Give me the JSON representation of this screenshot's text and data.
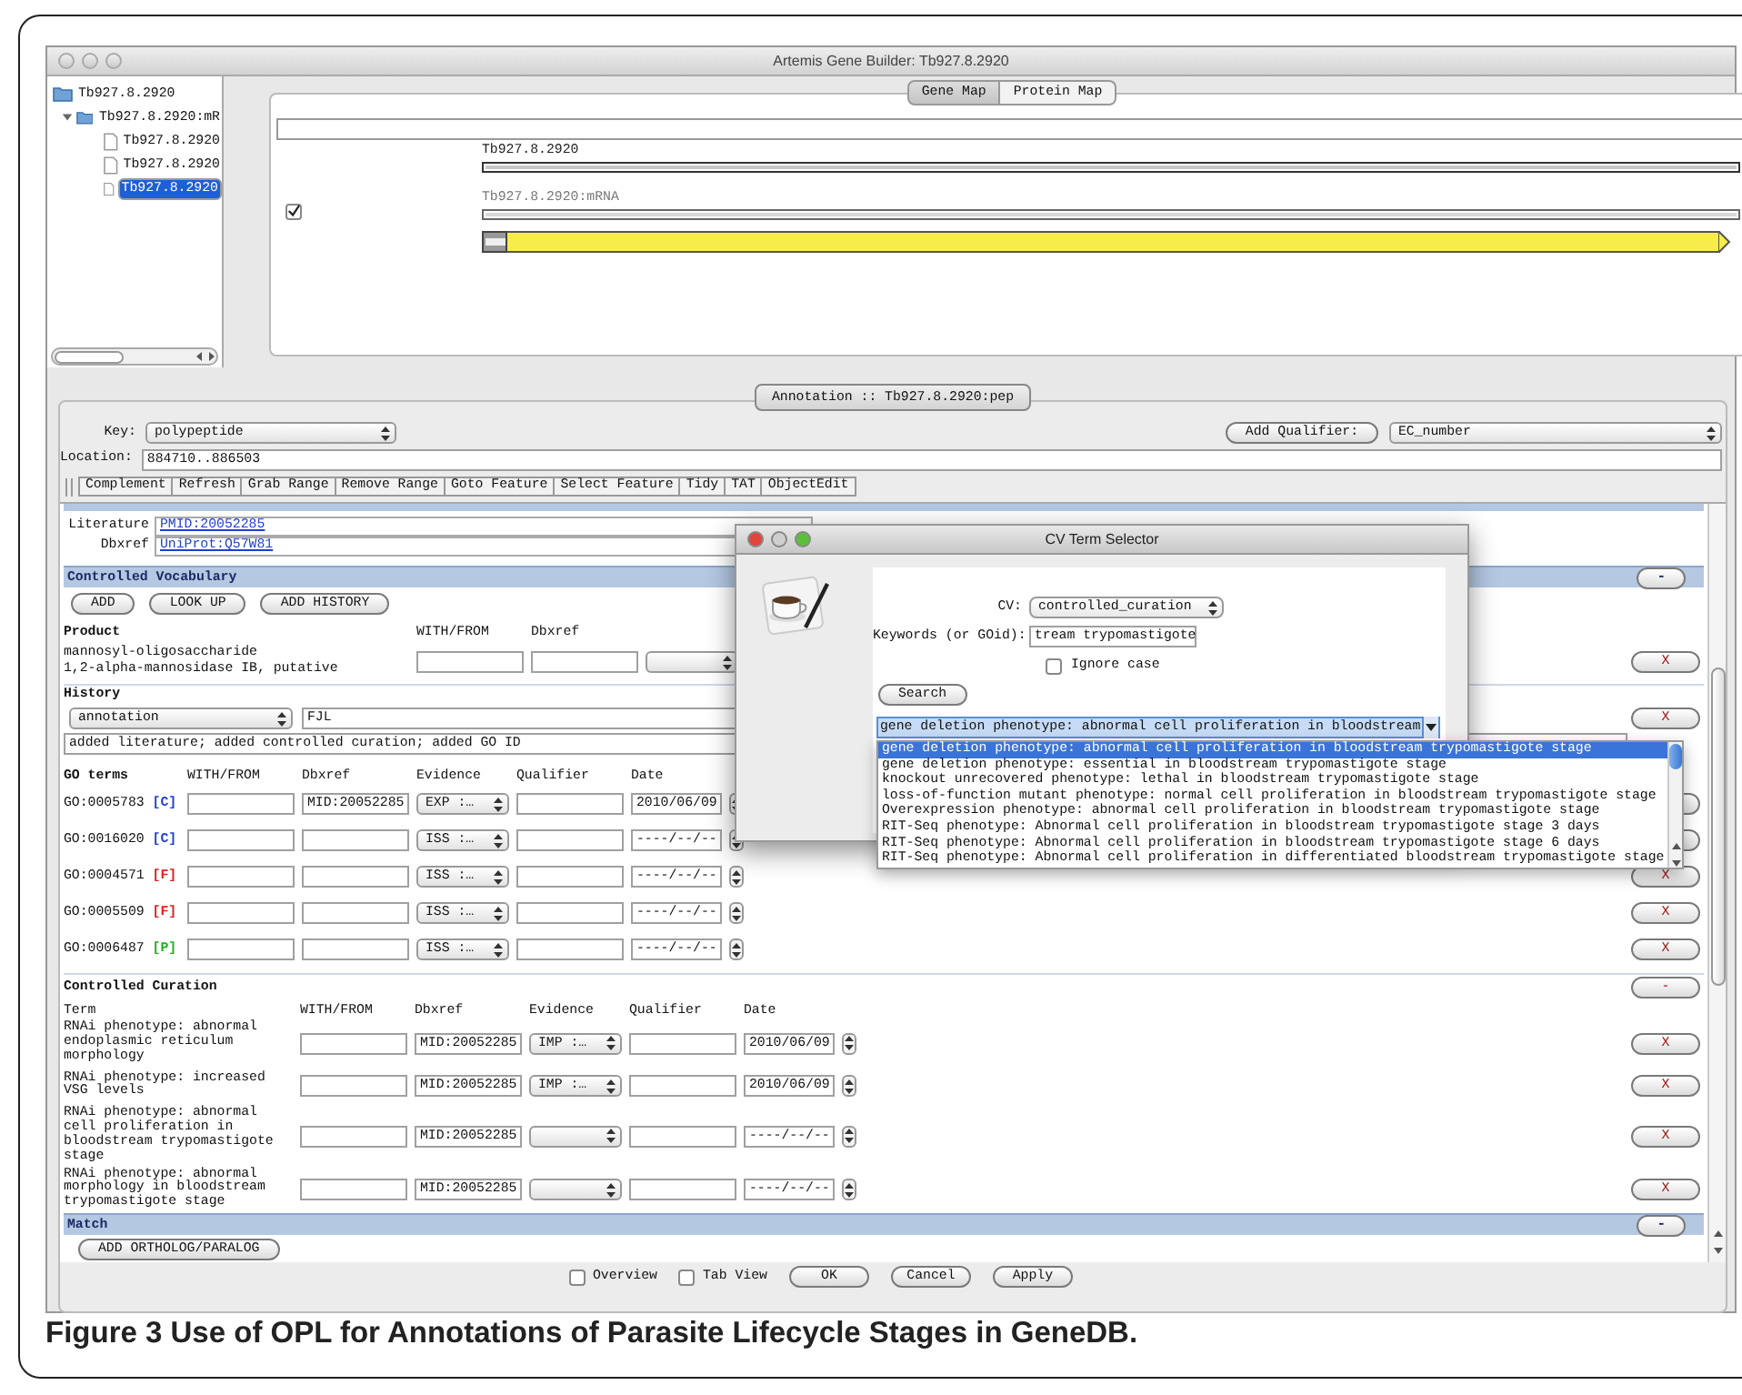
{
  "window": {
    "title": "Artemis Gene Builder: Tb927.8.2920"
  },
  "tree": [
    {
      "label": "Tb927.8.2920",
      "kind": "folder",
      "selected": false,
      "children": [
        {
          "label": "Tb927.8.2920:mR",
          "kind": "folder",
          "selected": false,
          "expanded": true,
          "children": [
            {
              "label": "Tb927.8.2920",
              "kind": "file",
              "selected": false
            },
            {
              "label": "Tb927.8.2920",
              "kind": "file",
              "selected": false
            },
            {
              "label": "Tb927.8.2920",
              "kind": "file",
              "selected": true
            }
          ]
        }
      ]
    }
  ],
  "map_tabs": [
    {
      "label": "Gene Map",
      "selected": true
    },
    {
      "label": "Protein Map",
      "selected": false
    }
  ],
  "gene_map": {
    "checked": true,
    "features": [
      {
        "kind": "gene",
        "label": "Tb927.8.2920"
      },
      {
        "kind": "mrna",
        "label": "Tb927.8.2920:mRNA"
      },
      {
        "kind": "cds"
      }
    ]
  },
  "annotation_tab": "Annotation :: Tb927.8.2920:pep",
  "key": {
    "label": "Key:",
    "value": "polypeptide"
  },
  "add_qualifier": {
    "button": "Add Qualifier:",
    "value": "EC_number"
  },
  "location": {
    "label": "Location:",
    "value": "884710..886503"
  },
  "toolbar": [
    "Complement",
    "Refresh",
    "Grab Range",
    "Remove Range",
    "Goto Feature",
    "Select Feature",
    "Tidy",
    "TAT",
    "ObjectEdit"
  ],
  "references": [
    {
      "label": "Literature",
      "value": "PMID:20052285"
    },
    {
      "label": "Dbxref",
      "value": "UniProt:Q57W81"
    }
  ],
  "controlled_vocabulary": {
    "title": "Controlled Vocabulary",
    "collapse": "-",
    "buttons": [
      "ADD",
      "LOOK UP",
      "ADD HISTORY"
    ]
  },
  "product": {
    "title": "Product",
    "columns": [
      "WITH/FROM",
      "Dbxref"
    ],
    "lines": [
      "mannosyl-oligosaccharide",
      "1,2-alpha-mannosidase IB, putative"
    ],
    "remove": "X"
  },
  "history": {
    "title": "History",
    "type": "annotation",
    "curator": "FJL",
    "text": "added literature; added controlled curation; added GO ID",
    "remove": "X"
  },
  "go_terms": {
    "columns": [
      "GO terms",
      "WITH/FROM",
      "Dbxref",
      "Evidence",
      "Qualifier",
      "Date"
    ],
    "rows": [
      {
        "id": "GO:0005783",
        "aspect": "[C]",
        "color": "#1f3fd0",
        "dbxref": "MID:20052285",
        "evidence": "EXP :…",
        "date": "2010/06/09"
      },
      {
        "id": "GO:0016020",
        "aspect": "[C]",
        "color": "#1f3fd0",
        "evidence": "ISS :…",
        "date": "----/--/--"
      },
      {
        "id": "GO:0004571",
        "aspect": "[F]",
        "color": "#e02020",
        "evidence": "ISS :…",
        "date": "----/--/--",
        "remove": "X"
      },
      {
        "id": "GO:0005509",
        "aspect": "[F]",
        "color": "#e02020",
        "evidence": "ISS :…",
        "date": "----/--/--",
        "remove": "X"
      },
      {
        "id": "GO:0006487",
        "aspect": "[P]",
        "color": "#20b020",
        "evidence": "ISS :…",
        "date": "----/--/--",
        "remove": "X"
      }
    ]
  },
  "controlled_curation": {
    "title": "Controlled Curation",
    "collapse": "-",
    "columns": [
      "Term",
      "WITH/FROM",
      "Dbxref",
      "Evidence",
      "Qualifier",
      "Date"
    ],
    "rows": [
      {
        "term": "RNAi phenotype: abnormal endoplasmic reticulum morphology",
        "dbxref": "MID:20052285",
        "evidence": "IMP :…",
        "date": "2010/06/09",
        "remove": "X"
      },
      {
        "term": "RNAi phenotype: increased VSG levels",
        "dbxref": "MID:20052285",
        "evidence": "IMP :…",
        "date": "2010/06/09",
        "remove": "X"
      },
      {
        "term": "RNAi phenotype: abnormal cell proliferation in bloodstream trypomastigote stage",
        "dbxref": "MID:20052285",
        "date": "----/--/--",
        "remove": "X"
      },
      {
        "term": "RNAi phenotype: abnormal morphology in bloodstream trypomastigote stage",
        "dbxref": "MID:20052285",
        "date": "----/--/--",
        "remove": "X"
      }
    ]
  },
  "match": {
    "title": "Match",
    "collapse": "-",
    "button": "ADD ORTHOLOG/PARALOG"
  },
  "bottom": {
    "checks": [
      {
        "label": "Overview",
        "checked": false
      },
      {
        "label": "Tab View",
        "checked": false
      }
    ],
    "buttons": [
      "OK",
      "Cancel",
      "Apply"
    ]
  },
  "cv_dialog": {
    "title": "CV Term Selector",
    "cv_label": "CV:",
    "cv": "controlled_curation",
    "keywords_label": "Keywords (or GOid):",
    "keywords": "tream trypomastigote",
    "ignore_case": {
      "label": "Ignore case",
      "checked": false
    },
    "search": "Search",
    "combo": "gene deletion phenotype: abnormal cell proliferation in bloodstream",
    "options": [
      {
        "label": "gene deletion phenotype: abnormal cell proliferation in bloodstream trypomastigote stage",
        "selected": true
      },
      {
        "label": "gene deletion phenotype: essential in bloodstream trypomastigote stage",
        "selected": false
      },
      {
        "label": "knockout unrecovered phenotype: lethal in bloodstream trypomastigote stage",
        "selected": false
      },
      {
        "label": "loss-of-function mutant phenotype: normal cell proliferation in bloodstream trypomastigote stage",
        "selected": false
      },
      {
        "label": "Overexpression phenotype: abnormal cell proliferation in bloodstream trypomastigote stage",
        "selected": false
      },
      {
        "label": "RIT-Seq phenotype: Abnormal cell proliferation in bloodstream trypomastigote stage 3 days",
        "selected": false
      },
      {
        "label": "RIT-Seq phenotype: Abnormal cell proliferation in bloodstream trypomastigote stage 6 days",
        "selected": false
      },
      {
        "label": "RIT-Seq phenotype: Abnormal cell proliferation in differentiated bloodstream trypomastigote stage",
        "selected": false
      }
    ]
  },
  "caption": "Figure 3 Use of OPL for Annotations of Parasite Lifecycle Stages in GeneDB."
}
